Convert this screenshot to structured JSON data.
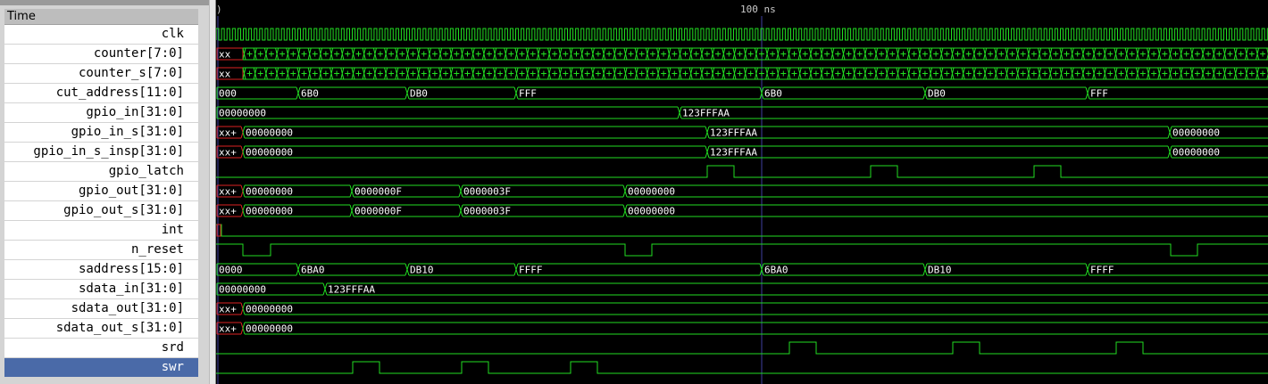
{
  "signal_panel": {
    "header": "Time",
    "signals": [
      {
        "name": "clk",
        "selected": false
      },
      {
        "name": "counter[7:0]",
        "selected": false
      },
      {
        "name": "counter_s[7:0]",
        "selected": false
      },
      {
        "name": "cut_address[11:0]",
        "selected": false
      },
      {
        "name": "gpio_in[31:0]",
        "selected": false
      },
      {
        "name": "gpio_in_s[31:0]",
        "selected": false
      },
      {
        "name": "gpio_in_s_insp[31:0]",
        "selected": false
      },
      {
        "name": "gpio_latch",
        "selected": false
      },
      {
        "name": "gpio_out[31:0]",
        "selected": false
      },
      {
        "name": "gpio_out_s[31:0]",
        "selected": false
      },
      {
        "name": "int",
        "selected": false
      },
      {
        "name": "n_reset",
        "selected": false
      },
      {
        "name": "saddress[15:0]",
        "selected": false
      },
      {
        "name": "sdata_in[31:0]",
        "selected": false
      },
      {
        "name": "sdata_out[31:0]",
        "selected": false
      },
      {
        "name": "sdata_out_s[31:0]",
        "selected": false
      },
      {
        "name": "srd",
        "selected": false
      },
      {
        "name": "swr",
        "selected": true
      }
    ]
  },
  "timeline": {
    "start_label": ")",
    "marker_label": "100 ns"
  },
  "waves": [
    {
      "name": "clk",
      "kind": "clock"
    },
    {
      "name": "counter[7:0]",
      "kind": "counter",
      "x_label": "xx"
    },
    {
      "name": "counter_s[7:0]",
      "kind": "counter",
      "x_label": "xx"
    },
    {
      "name": "cut_address[11:0]",
      "kind": "bus",
      "segments": [
        [
          "000"
        ],
        [
          "6B0"
        ],
        [
          "DB0"
        ],
        [
          "FFF"
        ],
        [
          "6B0"
        ],
        [
          "DB0"
        ],
        [
          "FFF"
        ]
      ]
    },
    {
      "name": "gpio_in[31:0]",
      "kind": "bus",
      "segments": [
        [
          "00000000"
        ],
        [
          "123FFFAA"
        ]
      ]
    },
    {
      "name": "gpio_in_s[31:0]",
      "kind": "bus",
      "segments": [
        [
          "xx+",
          "x"
        ],
        [
          "00000000"
        ],
        [
          "123FFFAA"
        ],
        [
          "00000000"
        ]
      ]
    },
    {
      "name": "gpio_in_s_insp[31:0]",
      "kind": "bus",
      "segments": [
        [
          "xx+",
          "x"
        ],
        [
          "00000000"
        ],
        [
          "123FFFAA"
        ],
        [
          "00000000"
        ]
      ]
    },
    {
      "name": "gpio_latch",
      "kind": "bit"
    },
    {
      "name": "gpio_out[31:0]",
      "kind": "bus",
      "segments": [
        [
          "xx+",
          "x"
        ],
        [
          "00000000"
        ],
        [
          "0000000F"
        ],
        [
          "0000003F"
        ],
        [
          "00000000"
        ]
      ]
    },
    {
      "name": "gpio_out_s[31:0]",
      "kind": "bus",
      "segments": [
        [
          "xx+",
          "x"
        ],
        [
          "00000000"
        ],
        [
          "0000000F"
        ],
        [
          "0000003F"
        ],
        [
          "00000000"
        ]
      ]
    },
    {
      "name": "int",
      "kind": "bit"
    },
    {
      "name": "n_reset",
      "kind": "bit"
    },
    {
      "name": "saddress[15:0]",
      "kind": "bus",
      "segments": [
        [
          "0000"
        ],
        [
          "6BA0"
        ],
        [
          "DB10"
        ],
        [
          "FFFF"
        ],
        [
          "6BA0"
        ],
        [
          "DB10"
        ],
        [
          "FFFF"
        ]
      ]
    },
    {
      "name": "sdata_in[31:0]",
      "kind": "bus",
      "segments": [
        [
          "00000000"
        ],
        [
          "123FFFAA"
        ]
      ]
    },
    {
      "name": "sdata_out[31:0]",
      "kind": "bus",
      "segments": [
        [
          "xx+",
          "x"
        ],
        [
          "00000000"
        ]
      ]
    },
    {
      "name": "sdata_out_s[31:0]",
      "kind": "bus",
      "segments": [
        [
          "xx+",
          "x"
        ],
        [
          "00000000"
        ]
      ]
    },
    {
      "name": "srd",
      "kind": "bit"
    },
    {
      "name": "swr",
      "kind": "bit"
    }
  ],
  "colors": {
    "wave": "#22dd22",
    "unknown": "#dd2222",
    "grid": "#2a2a4a",
    "marker": "#4040a0",
    "selected_row": "#4a6aa8"
  }
}
